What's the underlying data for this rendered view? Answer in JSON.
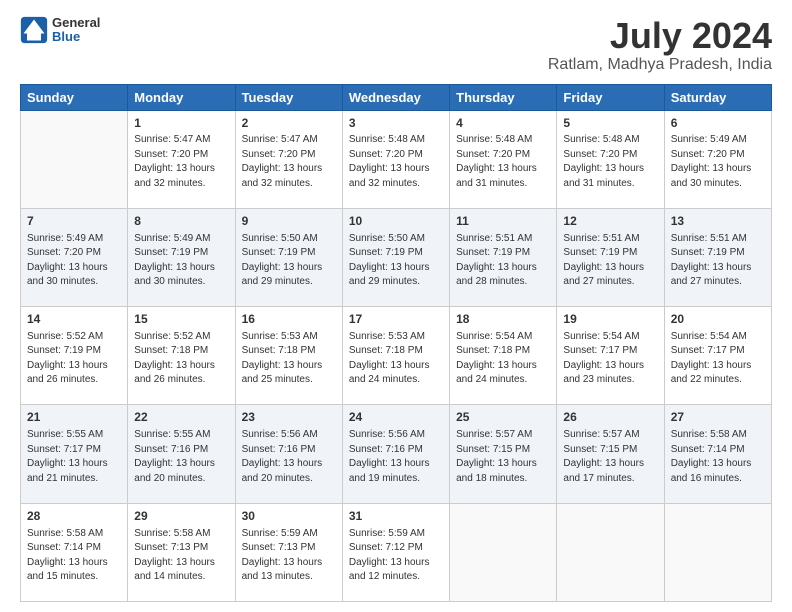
{
  "header": {
    "logo_general": "General",
    "logo_blue": "Blue",
    "title": "July 2024",
    "subtitle": "Ratlam, Madhya Pradesh, India"
  },
  "columns": [
    "Sunday",
    "Monday",
    "Tuesday",
    "Wednesday",
    "Thursday",
    "Friday",
    "Saturday"
  ],
  "weeks": [
    [
      {
        "day": "",
        "info": ""
      },
      {
        "day": "1",
        "info": "Sunrise: 5:47 AM\nSunset: 7:20 PM\nDaylight: 13 hours\nand 32 minutes."
      },
      {
        "day": "2",
        "info": "Sunrise: 5:47 AM\nSunset: 7:20 PM\nDaylight: 13 hours\nand 32 minutes."
      },
      {
        "day": "3",
        "info": "Sunrise: 5:48 AM\nSunset: 7:20 PM\nDaylight: 13 hours\nand 32 minutes."
      },
      {
        "day": "4",
        "info": "Sunrise: 5:48 AM\nSunset: 7:20 PM\nDaylight: 13 hours\nand 31 minutes."
      },
      {
        "day": "5",
        "info": "Sunrise: 5:48 AM\nSunset: 7:20 PM\nDaylight: 13 hours\nand 31 minutes."
      },
      {
        "day": "6",
        "info": "Sunrise: 5:49 AM\nSunset: 7:20 PM\nDaylight: 13 hours\nand 30 minutes."
      }
    ],
    [
      {
        "day": "7",
        "info": "Sunrise: 5:49 AM\nSunset: 7:20 PM\nDaylight: 13 hours\nand 30 minutes."
      },
      {
        "day": "8",
        "info": "Sunrise: 5:49 AM\nSunset: 7:19 PM\nDaylight: 13 hours\nand 30 minutes."
      },
      {
        "day": "9",
        "info": "Sunrise: 5:50 AM\nSunset: 7:19 PM\nDaylight: 13 hours\nand 29 minutes."
      },
      {
        "day": "10",
        "info": "Sunrise: 5:50 AM\nSunset: 7:19 PM\nDaylight: 13 hours\nand 29 minutes."
      },
      {
        "day": "11",
        "info": "Sunrise: 5:51 AM\nSunset: 7:19 PM\nDaylight: 13 hours\nand 28 minutes."
      },
      {
        "day": "12",
        "info": "Sunrise: 5:51 AM\nSunset: 7:19 PM\nDaylight: 13 hours\nand 27 minutes."
      },
      {
        "day": "13",
        "info": "Sunrise: 5:51 AM\nSunset: 7:19 PM\nDaylight: 13 hours\nand 27 minutes."
      }
    ],
    [
      {
        "day": "14",
        "info": "Sunrise: 5:52 AM\nSunset: 7:19 PM\nDaylight: 13 hours\nand 26 minutes."
      },
      {
        "day": "15",
        "info": "Sunrise: 5:52 AM\nSunset: 7:18 PM\nDaylight: 13 hours\nand 26 minutes."
      },
      {
        "day": "16",
        "info": "Sunrise: 5:53 AM\nSunset: 7:18 PM\nDaylight: 13 hours\nand 25 minutes."
      },
      {
        "day": "17",
        "info": "Sunrise: 5:53 AM\nSunset: 7:18 PM\nDaylight: 13 hours\nand 24 minutes."
      },
      {
        "day": "18",
        "info": "Sunrise: 5:54 AM\nSunset: 7:18 PM\nDaylight: 13 hours\nand 24 minutes."
      },
      {
        "day": "19",
        "info": "Sunrise: 5:54 AM\nSunset: 7:17 PM\nDaylight: 13 hours\nand 23 minutes."
      },
      {
        "day": "20",
        "info": "Sunrise: 5:54 AM\nSunset: 7:17 PM\nDaylight: 13 hours\nand 22 minutes."
      }
    ],
    [
      {
        "day": "21",
        "info": "Sunrise: 5:55 AM\nSunset: 7:17 PM\nDaylight: 13 hours\nand 21 minutes."
      },
      {
        "day": "22",
        "info": "Sunrise: 5:55 AM\nSunset: 7:16 PM\nDaylight: 13 hours\nand 20 minutes."
      },
      {
        "day": "23",
        "info": "Sunrise: 5:56 AM\nSunset: 7:16 PM\nDaylight: 13 hours\nand 20 minutes."
      },
      {
        "day": "24",
        "info": "Sunrise: 5:56 AM\nSunset: 7:16 PM\nDaylight: 13 hours\nand 19 minutes."
      },
      {
        "day": "25",
        "info": "Sunrise: 5:57 AM\nSunset: 7:15 PM\nDaylight: 13 hours\nand 18 minutes."
      },
      {
        "day": "26",
        "info": "Sunrise: 5:57 AM\nSunset: 7:15 PM\nDaylight: 13 hours\nand 17 minutes."
      },
      {
        "day": "27",
        "info": "Sunrise: 5:58 AM\nSunset: 7:14 PM\nDaylight: 13 hours\nand 16 minutes."
      }
    ],
    [
      {
        "day": "28",
        "info": "Sunrise: 5:58 AM\nSunset: 7:14 PM\nDaylight: 13 hours\nand 15 minutes."
      },
      {
        "day": "29",
        "info": "Sunrise: 5:58 AM\nSunset: 7:13 PM\nDaylight: 13 hours\nand 14 minutes."
      },
      {
        "day": "30",
        "info": "Sunrise: 5:59 AM\nSunset: 7:13 PM\nDaylight: 13 hours\nand 13 minutes."
      },
      {
        "day": "31",
        "info": "Sunrise: 5:59 AM\nSunset: 7:12 PM\nDaylight: 13 hours\nand 12 minutes."
      },
      {
        "day": "",
        "info": ""
      },
      {
        "day": "",
        "info": ""
      },
      {
        "day": "",
        "info": ""
      }
    ]
  ]
}
